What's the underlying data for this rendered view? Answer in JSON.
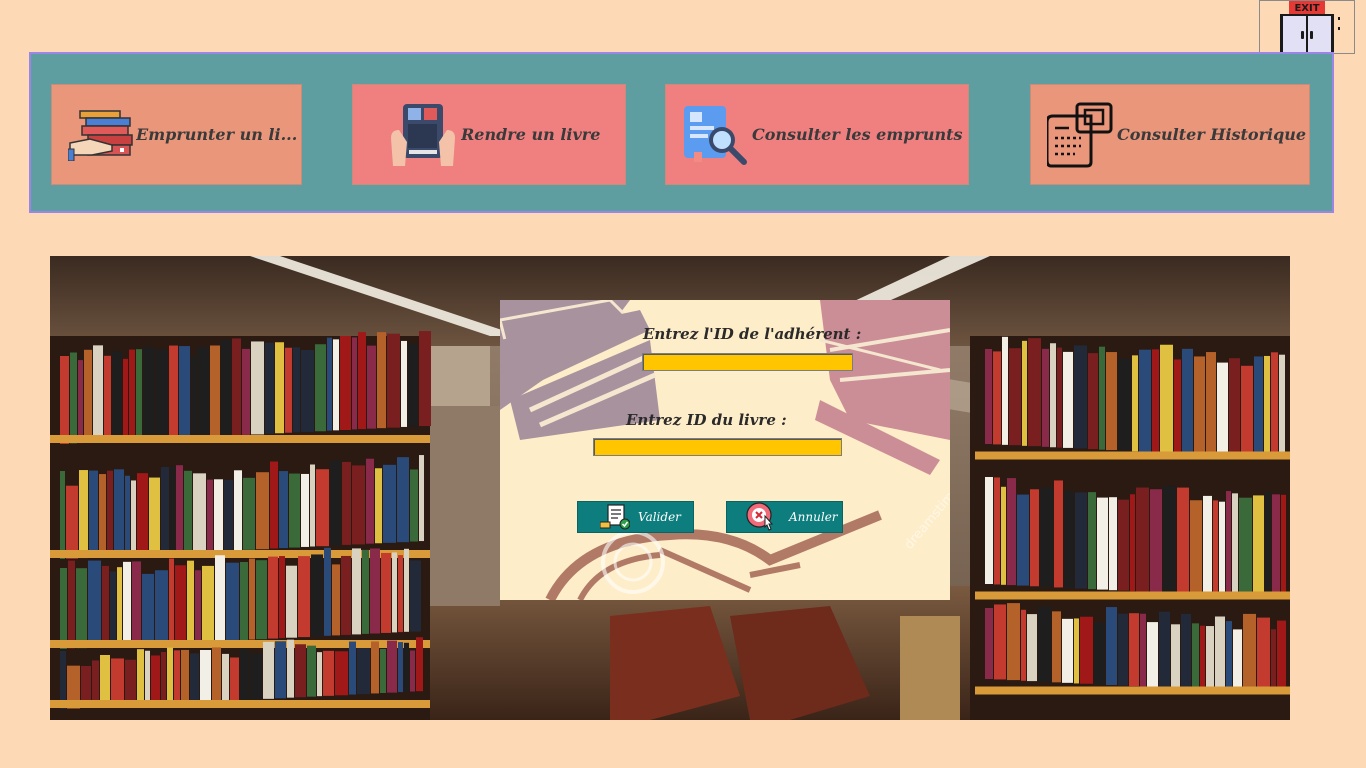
{
  "exit": {
    "sign": "EXIT",
    "icon": "exit-door-icon"
  },
  "nav": {
    "items": [
      {
        "id": "emprunter",
        "label": "Emprunter un li...",
        "icon": "books-in-hand-icon"
      },
      {
        "id": "rendre",
        "label": "Rendre un livre",
        "icon": "hands-holding-book-icon"
      },
      {
        "id": "consulter",
        "label": "Consulter les emprunts",
        "icon": "document-search-icon"
      },
      {
        "id": "historique",
        "label": "Consulter Historique",
        "icon": "history-document-icon"
      }
    ]
  },
  "form": {
    "adherent_label": "Entrez l'ID de l'adhérent :",
    "adherent_value": "",
    "livre_label": "Entrez ID du livre :",
    "livre_value": "",
    "valider_label": "Valider",
    "annuler_label": "Annuler",
    "watermark": "dreamstime"
  },
  "colors": {
    "background": "#fdd9b5",
    "nav_panel": "#5f9ea0",
    "nav_border": "#9b85e6",
    "nav_button_salmon": "#e9967a",
    "nav_button_coral": "#f08080",
    "input_fill": "#ffc600",
    "form_button": "#0d7d7d",
    "form_card": "#feedc9"
  }
}
